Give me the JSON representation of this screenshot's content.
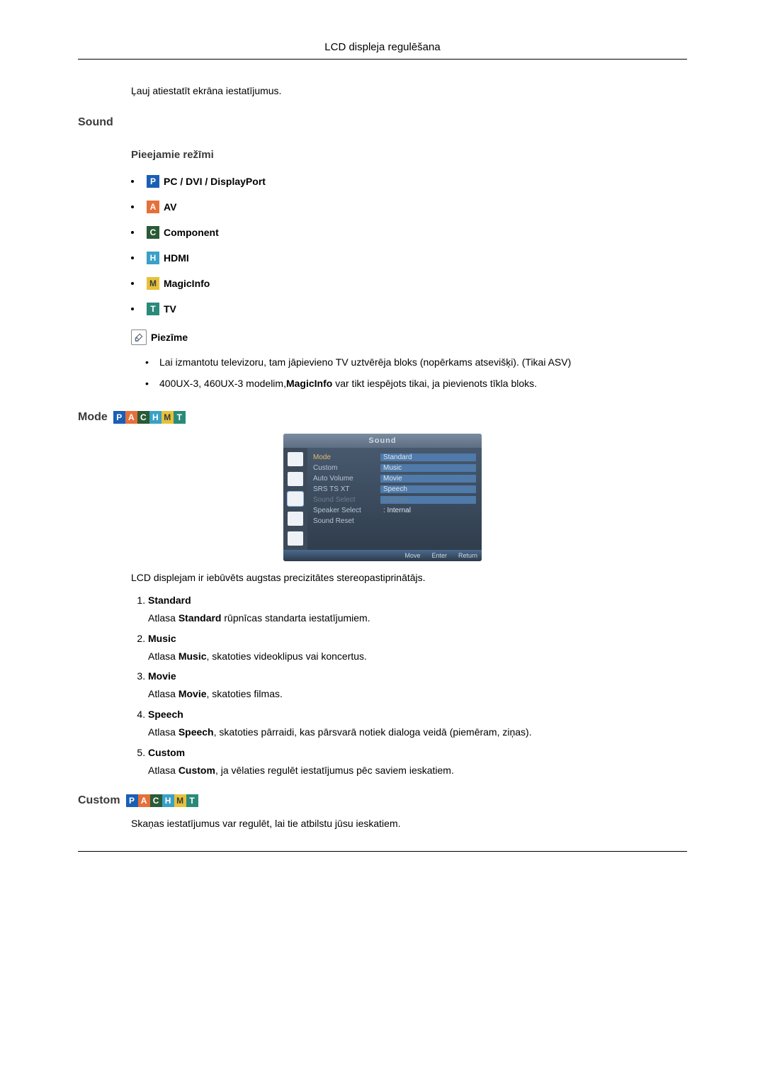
{
  "header": {
    "title": "LCD displeja regulēšana"
  },
  "intro": "Ļauj atiestatīt ekrāna iestatījumus.",
  "sound": {
    "heading": "Sound",
    "available_heading": "Pieejamie režīmi",
    "modes": [
      {
        "letter": "P",
        "cls": "bg-blue",
        "label": "PC / DVI / DisplayPort"
      },
      {
        "letter": "A",
        "cls": "bg-orange",
        "label": "AV"
      },
      {
        "letter": "C",
        "cls": "bg-dgreen",
        "label": "Component"
      },
      {
        "letter": "H",
        "cls": "bg-cyan",
        "label": "HDMI"
      },
      {
        "letter": "M",
        "cls": "bg-yellow",
        "label": "MagicInfo"
      },
      {
        "letter": "T",
        "cls": "bg-teal",
        "label": "TV"
      }
    ],
    "note_label": "Piezīme",
    "notes": [
      "Lai izmantotu televizoru, tam jāpievieno TV uztvērēja bloks (nopērkams atsevišķi). (Tikai ASV)",
      "400UX-3, 460UX-3 modelim,<b>MagicInfo</b> var tikt iespējots tikai, ja pievienots tīkla bloks."
    ]
  },
  "mode_section": {
    "heading": "Mode",
    "osd": {
      "title": "Sound",
      "rows": [
        {
          "l": "Mode",
          "r": "Standard",
          "sel": true,
          "hl": true
        },
        {
          "l": "Custom",
          "r": "Music",
          "hl": true
        },
        {
          "l": "Auto Volume",
          "r": "Movie",
          "hl": true
        },
        {
          "l": "SRS TS XT",
          "r": "Speech",
          "hl": true
        },
        {
          "l": "Sound Select",
          "r": "Custom",
          "dim": true,
          "hl": true,
          "rdim": true
        },
        {
          "l": "Speaker Select",
          "r": ": Internal"
        },
        {
          "l": "Sound Reset",
          "r": ""
        }
      ],
      "footer": [
        "Move",
        "Enter",
        "Return"
      ]
    },
    "desc": "LCD displejam ir iebūvēts augstas precizitātes stereopastiprinātājs.",
    "options": [
      {
        "name": "Standard",
        "desc": "Atlasa <b>Standard</b> rūpnīcas standarta iestatījumiem."
      },
      {
        "name": "Music",
        "desc": "Atlasa <b>Music</b>, skatoties videoklipus vai koncertus."
      },
      {
        "name": "Movie",
        "desc": "Atlasa <b>Movie</b>, skatoties filmas."
      },
      {
        "name": "Speech",
        "desc": "Atlasa <b>Speech</b>, skatoties pārraidi, kas pārsvarā notiek dialoga veidā (piemēram, ziņas)."
      },
      {
        "name": "Custom",
        "desc": "Atlasa <b>Custom</b>, ja vēlaties regulēt iestatījumus pēc saviem ieskatiem."
      }
    ]
  },
  "custom_section": {
    "heading": "Custom",
    "desc": "Skaņas iestatījumus var regulēt, lai tie atbilstu jūsu ieskatiem."
  }
}
